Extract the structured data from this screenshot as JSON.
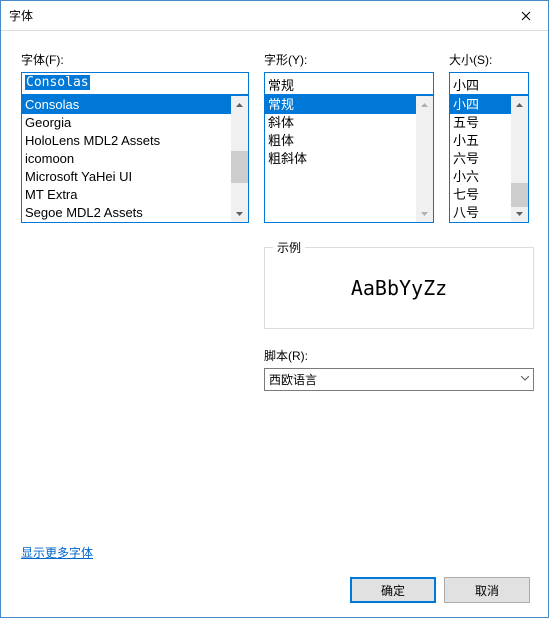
{
  "window": {
    "title": "字体"
  },
  "font": {
    "label": "字体(F):",
    "value": "Consolas",
    "items": [
      "Consolas",
      "Georgia",
      "HoloLens MDL2 Assets",
      "icomoon",
      "Microsoft YaHei UI",
      "MT Extra",
      "Segoe MDL2 Assets"
    ],
    "selected_index": 0
  },
  "style": {
    "label": "字形(Y):",
    "value": "常规",
    "items": [
      "常规",
      "斜体",
      "粗体",
      "粗斜体"
    ],
    "selected_index": 0
  },
  "size": {
    "label": "大小(S):",
    "value": "小四",
    "items": [
      "小四",
      "五号",
      "小五",
      "六号",
      "小六",
      "七号",
      "八号"
    ],
    "selected_index": 0
  },
  "sample": {
    "legend": "示例",
    "text": "AaBbYyZz"
  },
  "script": {
    "label": "脚本(R):",
    "value": "西欧语言"
  },
  "link": "显示更多字体",
  "buttons": {
    "ok": "确定",
    "cancel": "取消"
  }
}
